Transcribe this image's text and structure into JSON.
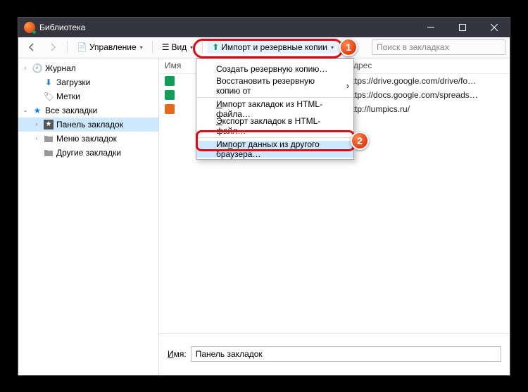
{
  "window": {
    "title": "Библиотека"
  },
  "toolbar": {
    "manage_label": "Управление",
    "view_label": "Вид",
    "import_label": "Импорт и резервные копии",
    "search_placeholder": "Поиск в закладках"
  },
  "sidebar": {
    "items": [
      {
        "label": "Журнал",
        "depth": 0,
        "expander": "›",
        "icon": "clock"
      },
      {
        "label": "Загрузки",
        "depth": 1,
        "expander": "",
        "icon": "download"
      },
      {
        "label": "Метки",
        "depth": 1,
        "expander": "",
        "icon": "tag"
      },
      {
        "label": "Все закладки",
        "depth": 0,
        "expander": "⌄",
        "icon": "star"
      },
      {
        "label": "Панель закладок",
        "depth": 1,
        "expander": "›",
        "icon": "starbox",
        "selected": true
      },
      {
        "label": "Меню закладок",
        "depth": 1,
        "expander": "›",
        "icon": "folder"
      },
      {
        "label": "Другие закладки",
        "depth": 1,
        "expander": "",
        "icon": "folder"
      }
    ]
  },
  "columns": {
    "name": "Имя",
    "address": "Адрес"
  },
  "rows": [
    {
      "favicon": "#0f9d58",
      "address": "https://drive.google.com/drive/fo…"
    },
    {
      "favicon": "#0f9d58",
      "address": "https://docs.google.com/spreads…"
    },
    {
      "favicon": "#e46a1a",
      "address": "http://lumpics.ru/"
    }
  ],
  "menu": {
    "items": [
      {
        "label": "Создать резервную копию…"
      },
      {
        "label": "Восстановить резервную копию от",
        "sub": true
      },
      {
        "sep": true
      },
      {
        "label": "Импорт закладок из HTML-файла…",
        "u": 0
      },
      {
        "label": "Экспорт закладок в HTML-файл…",
        "u": 0
      },
      {
        "sep": true
      },
      {
        "label": "Импорт данных из другого браузера…",
        "u": 2,
        "highlight": true
      }
    ]
  },
  "details": {
    "name_label": "Имя:",
    "name_value": "Панель закладок"
  },
  "annotations": {
    "badge1": "1",
    "badge2": "2"
  }
}
